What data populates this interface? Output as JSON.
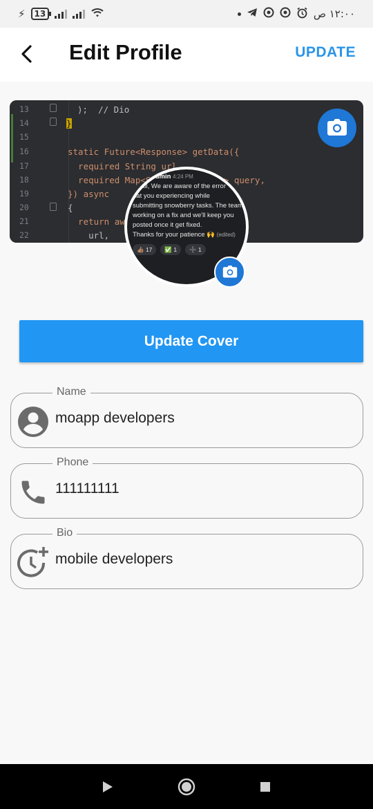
{
  "status_bar": {
    "battery_level": "13",
    "time": "١٢:٠٠ ص"
  },
  "header": {
    "title": "Edit Profile",
    "update_label": "UPDATE"
  },
  "cover": {
    "code_lines": [
      {
        "num": "13",
        "text": ");  // Dio"
      },
      {
        "num": "14",
        "text": "}"
      },
      {
        "num": "15",
        "text": ""
      },
      {
        "num": "16",
        "text": "static Future<Response> getData({"
      },
      {
        "num": "17",
        "text": "  required String url,"
      },
      {
        "num": "18",
        "text": "  required Map<String, dynamic> query,"
      },
      {
        "num": "19",
        "text": "}) async"
      },
      {
        "num": "20",
        "text": "{"
      },
      {
        "num": "21",
        "text": "  return await dio.get("
      },
      {
        "num": "22",
        "text": "    url,"
      }
    ]
  },
  "avatar_chat": {
    "sender": "Admin",
    "time": "4:24 PM",
    "tag": "nnel",
    "lines": [
      "llo all, We are aware of the error",
      "hat you experiencing  while",
      "submitting snowberry tasks. The team",
      "working on a fix and we'll keep you",
      "posted once it get fixed.",
      "Thanks for your patience 🙌"
    ],
    "edited": "(edited)",
    "reactions": [
      "👍🏽 17",
      "✅ 1",
      "➕ 1"
    ]
  },
  "update_cover_label": "Update Cover",
  "fields": {
    "name": {
      "label": "Name",
      "value": "moapp developers"
    },
    "phone": {
      "label": "Phone",
      "value": "111111111"
    },
    "bio": {
      "label": "Bio",
      "value": "mobile developers"
    }
  },
  "icons": {
    "back": "arrow-back-icon",
    "camera": "camera-icon",
    "person": "account-circle-icon",
    "phone": "phone-icon",
    "bio": "history-add-icon"
  },
  "colors": {
    "accent": "#2196f3",
    "update_text": "#2a94e8",
    "camera_bg": "#1f77d6"
  }
}
